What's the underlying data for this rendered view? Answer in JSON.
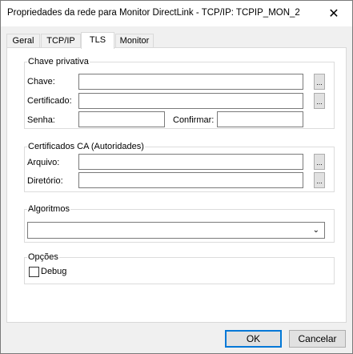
{
  "window": {
    "title": "Propriedades da rede para Monitor DirectLink - TCP/IP: TCPIP_MON_2",
    "close_glyph": "✕"
  },
  "tabs": [
    {
      "label": "Geral"
    },
    {
      "label": "TCP/IP"
    },
    {
      "label": "TLS"
    },
    {
      "label": "Monitor"
    }
  ],
  "private_key": {
    "title": "Chave privativa",
    "key_label": "Chave:",
    "key_value": "",
    "cert_label": "Certificado:",
    "cert_value": "",
    "password_label": "Senha:",
    "password_value": "",
    "confirm_label": "Confirmar:",
    "confirm_value": "",
    "browse_label": "..."
  },
  "ca_certs": {
    "title": "Certificados CA (Autoridades)",
    "file_label": "Arquivo:",
    "file_value": "",
    "dir_label": "Diretório:",
    "dir_value": "",
    "browse_label": "..."
  },
  "algorithms": {
    "title": "Algoritmos",
    "selected": ""
  },
  "options": {
    "title": "Opções",
    "debug_label": "Debug",
    "debug_checked": false
  },
  "buttons": {
    "ok": "OK",
    "cancel": "Cancelar"
  }
}
